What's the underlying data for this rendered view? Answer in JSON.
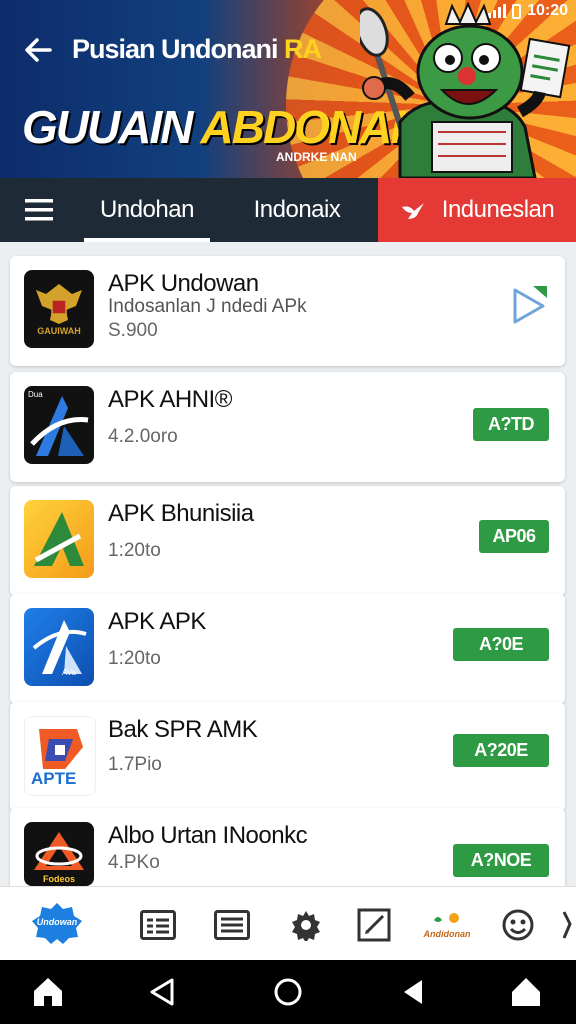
{
  "status": {
    "time": "10:20"
  },
  "header": {
    "title_part1": "Pusian Undonani ",
    "title_part2": "RA",
    "banner_part1": "GUUAIN ",
    "banner_part2": "ABDONAN",
    "banner_small": "ANDRKE NAN"
  },
  "tabs": [
    {
      "label": "Undohan"
    },
    {
      "label": "Indonaix"
    },
    {
      "label": "Induneslan"
    }
  ],
  "apps": [
    {
      "name": "APK Undowan",
      "subtitle": "Indosanlan J ndedi APk",
      "meta": "S.900",
      "icon_text": "GAUIWAH",
      "action": "play"
    },
    {
      "name": "APK AHNI®",
      "meta": "4.2.0oro",
      "icon_text": "Dua",
      "action_label": "A?TD"
    },
    {
      "name": "APK Bhunisiia",
      "meta": "1:20to",
      "action_label": "AP06"
    },
    {
      "name": "APK APK",
      "meta": "1:20to",
      "icon_text": "AVa",
      "action_label": "A?0E"
    },
    {
      "name": "Bak SPR AMK",
      "meta": "1.7Pio",
      "icon_text": "APTE",
      "action_label": "A?20E"
    },
    {
      "name": "Albo Urtan INoonkc",
      "meta": "4.PKo",
      "icon_text": "Fodeos",
      "action_label": "A?NOE"
    }
  ],
  "bottom_nav": {
    "badge_text": "Undowan",
    "brand_text": "Andidonan",
    "items": [
      "home-badge-icon",
      "list-icon",
      "news-icon",
      "settings-icon",
      "edit-icon",
      "brand-icon",
      "smile-icon"
    ]
  },
  "colors": {
    "accent_green": "#2e9a43",
    "tab_bg": "#1e2a35",
    "tab_red": "#e53935"
  }
}
